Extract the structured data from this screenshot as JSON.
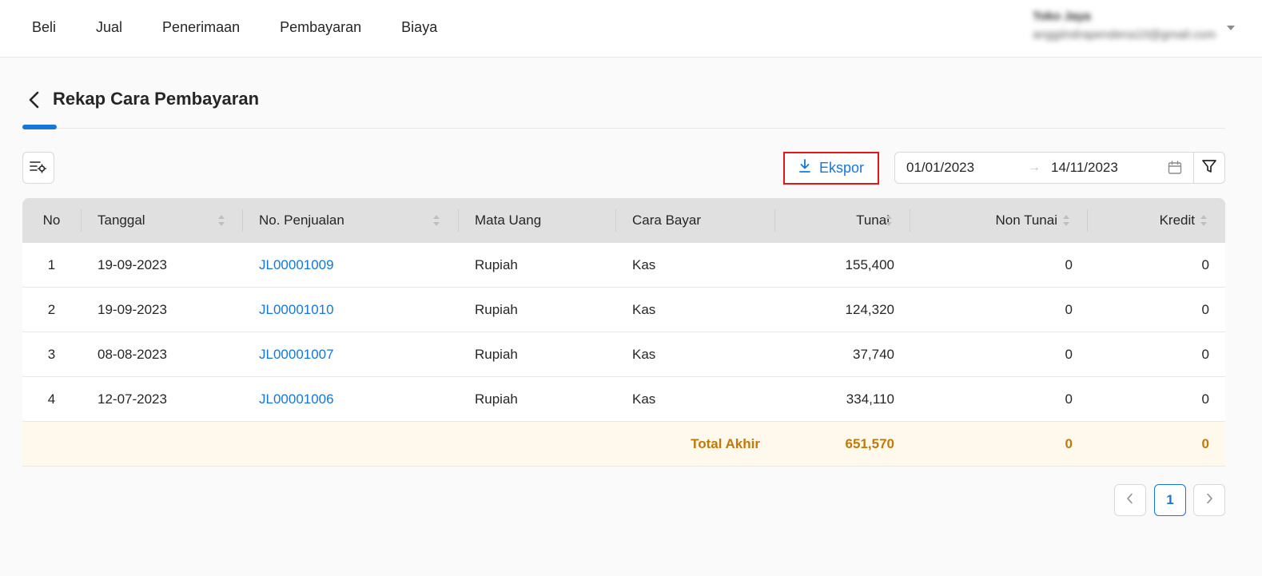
{
  "nav": {
    "items": [
      {
        "label": "Beli"
      },
      {
        "label": "Jual"
      },
      {
        "label": "Penerimaan"
      },
      {
        "label": "Pembayaran"
      },
      {
        "label": "Biaya"
      }
    ]
  },
  "user": {
    "name": "Toko Jaya",
    "email": "anggiindrapendena10@gmail.com"
  },
  "page": {
    "title": "Rekap Cara Pembayaran"
  },
  "toolbar": {
    "export_label": "Ekspor",
    "date_start": "01/01/2023",
    "date_separator": "→",
    "date_end": "14/11/2023"
  },
  "table": {
    "headers": {
      "no": "No",
      "tanggal": "Tanggal",
      "no_penjualan": "No. Penjualan",
      "mata_uang": "Mata Uang",
      "cara_bayar": "Cara Bayar",
      "tunai": "Tunai",
      "non_tunai": "Non Tunai",
      "kredit": "Kredit"
    },
    "rows": [
      {
        "no": "1",
        "tanggal": "19-09-2023",
        "no_penjualan": "JL00001009",
        "mata_uang": "Rupiah",
        "cara_bayar": "Kas",
        "tunai": "155,400",
        "non_tunai": "0",
        "kredit": "0"
      },
      {
        "no": "2",
        "tanggal": "19-09-2023",
        "no_penjualan": "JL00001010",
        "mata_uang": "Rupiah",
        "cara_bayar": "Kas",
        "tunai": "124,320",
        "non_tunai": "0",
        "kredit": "0"
      },
      {
        "no": "3",
        "tanggal": "08-08-2023",
        "no_penjualan": "JL00001007",
        "mata_uang": "Rupiah",
        "cara_bayar": "Kas",
        "tunai": "37,740",
        "non_tunai": "0",
        "kredit": "0"
      },
      {
        "no": "4",
        "tanggal": "12-07-2023",
        "no_penjualan": "JL00001006",
        "mata_uang": "Rupiah",
        "cara_bayar": "Kas",
        "tunai": "334,110",
        "non_tunai": "0",
        "kredit": "0"
      }
    ],
    "total": {
      "label": "Total Akhir",
      "tunai": "651,570",
      "non_tunai": "0",
      "kredit": "0"
    }
  },
  "pagination": {
    "current_page": "1"
  },
  "colors": {
    "accent": "#1677d8",
    "export_highlight": "#e3161c",
    "total_text": "#c0790b",
    "total_bg": "#fff8ec"
  }
}
